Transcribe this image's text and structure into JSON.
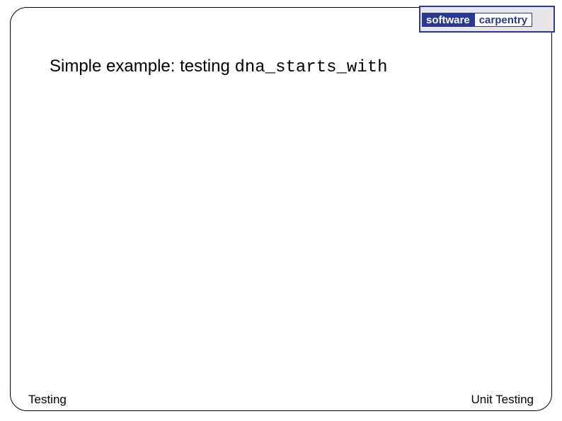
{
  "logo": {
    "left": "software",
    "right": "carpentry",
    "top_strip": "",
    "bottom_strip": ""
  },
  "title": {
    "prefix": "Simple example: testing ",
    "code": "dna_starts_with"
  },
  "footer": {
    "left": "Testing",
    "right": "Unit Testing"
  }
}
